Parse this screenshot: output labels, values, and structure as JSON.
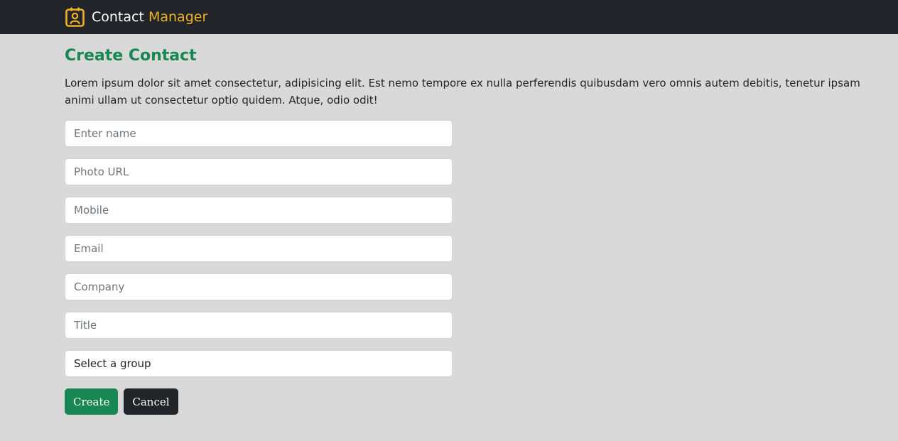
{
  "navbar": {
    "brand_word_1": "Contact",
    "brand_word_2": "Manager",
    "brand_icon": "contact-book-icon",
    "brand_color": "#f0b323",
    "background": "#212529"
  },
  "main": {
    "title": "Create Contact",
    "intro": "Lorem ipsum dolor sit amet consectetur, adipisicing elit. Est nemo tempore ex nulla perferendis quibusdam vero omnis autem debitis, tenetur ipsam animi ullam ut consectetur optio quidem. Atque, odio odit!"
  },
  "form": {
    "name_placeholder": "Enter name",
    "name_value": "",
    "photo_placeholder": "Photo URL",
    "photo_value": "",
    "mobile_placeholder": "Mobile",
    "mobile_value": "",
    "email_placeholder": "Email",
    "email_value": "",
    "company_placeholder": "Company",
    "company_value": "",
    "title_placeholder": "Title",
    "title_value": "",
    "group_selected": "Select a group",
    "create_label": "Create",
    "cancel_label": "Cancel"
  },
  "colors": {
    "accent_green": "#198754",
    "dark": "#212529",
    "page_background": "#d9d9d9"
  }
}
